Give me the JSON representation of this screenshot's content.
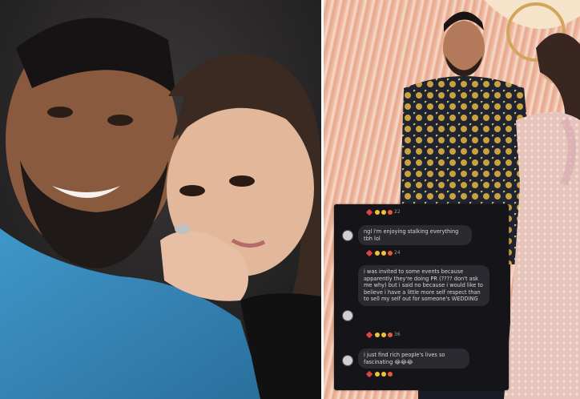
{
  "colors": {
    "left_background": "#2b2a2c",
    "right_background": "#e9b9a2",
    "chat_background": "#151418",
    "bubble_background": "#2b2a30",
    "text": "#d8d8d8"
  },
  "left_photo": {
    "subjects": [
      "bearded-man-smiling",
      "young-woman-resting-chin-on-hand"
    ]
  },
  "right_photo": {
    "subjects": [
      "groom-in-gold-embroidered-sherwani",
      "bride-in-pink-lehenga"
    ]
  },
  "chat": {
    "top_reaction": {
      "count": "22"
    },
    "messages": [
      {
        "text": "ngl i'm enjoying stalking everything tbh lol",
        "reactions_count": "24"
      },
      {
        "text": "i was invited to some events because apparently they're doing PR (???? don't ask me why) but i said no because i would like to believe i have a little more self respect than to sell my self out for someone's WEDDING",
        "reactions_count": "36"
      },
      {
        "text": "i just find rich people's lives so fascinating 😂😂😂",
        "reactions_count": ""
      }
    ]
  }
}
